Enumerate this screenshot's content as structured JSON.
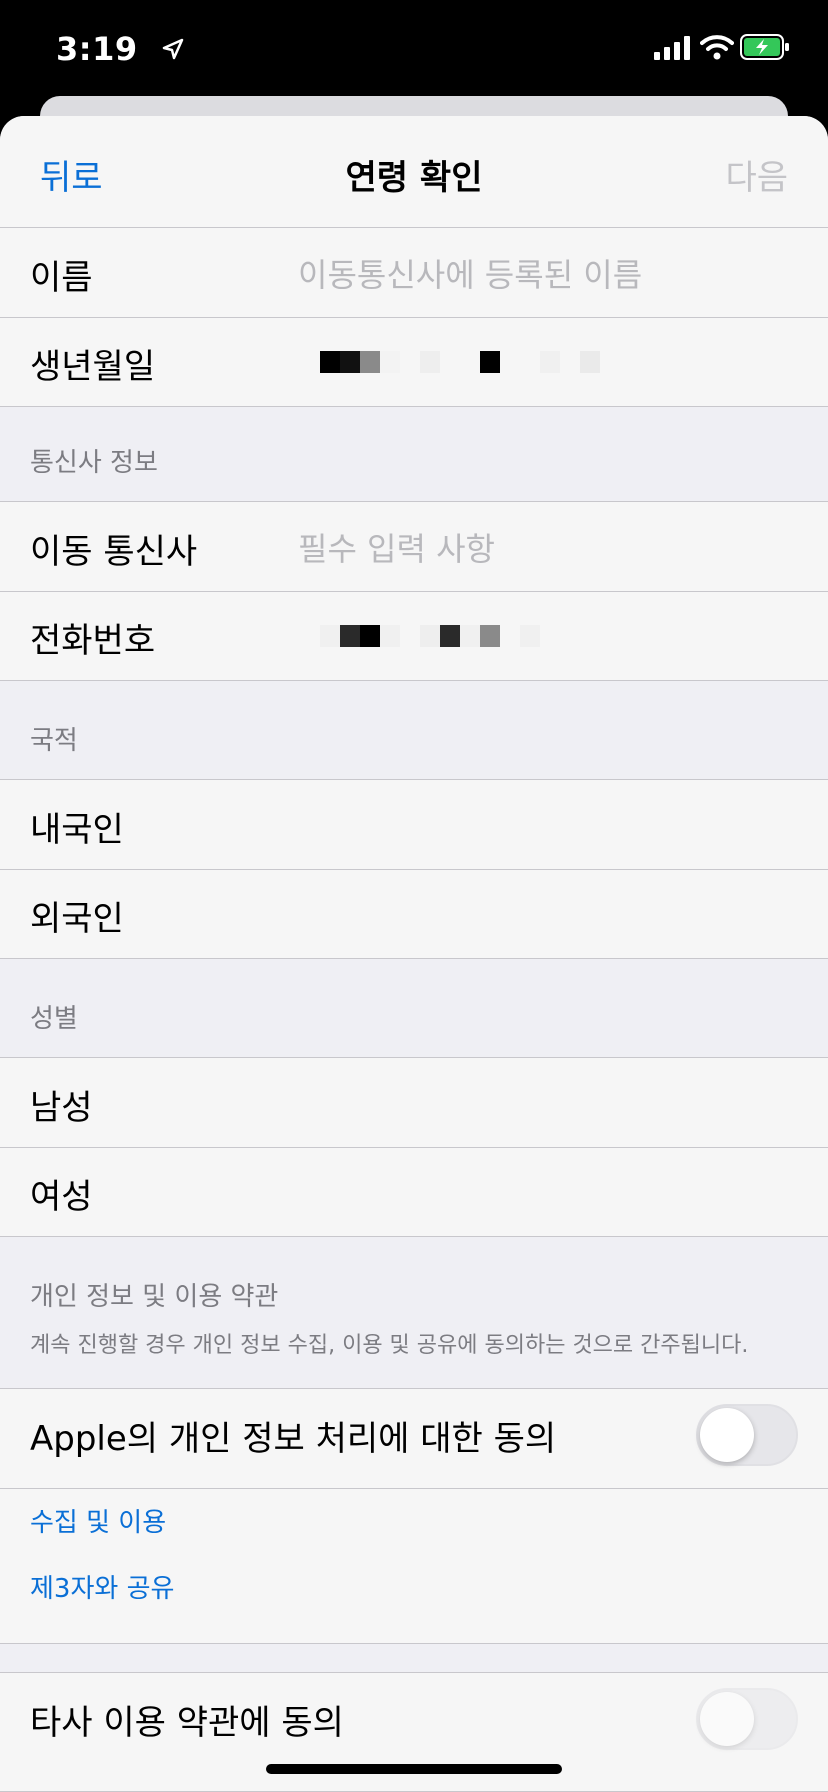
{
  "status_bar": {
    "time": "3:19",
    "icons": [
      "location-arrow-icon",
      "cellular-signal-icon",
      "wifi-icon",
      "battery-charging-icon"
    ],
    "battery_color": "#34c759"
  },
  "nav": {
    "back_label": "뒤로",
    "title": "연령 확인",
    "next_label": "다음"
  },
  "identity": {
    "name_label": "이름",
    "name_placeholder": "이동통신사에 등록된 이름",
    "birth_label": "생년월일"
  },
  "carrier_section": {
    "header": "통신사 정보",
    "carrier_label": "이동 통신사",
    "carrier_placeholder": "필수 입력 사항",
    "phone_label": "전화번호"
  },
  "nationality_section": {
    "header": "국적",
    "options": [
      "내국인",
      "외국인"
    ]
  },
  "gender_section": {
    "header": "성별",
    "options": [
      "남성",
      "여성"
    ]
  },
  "privacy": {
    "title": "개인 정보 및 이용 약관",
    "description": "계속 진행할 경우 개인 정보 수집, 이용 및 공유에 동의하는 것으로 간주됩니다.",
    "apple_consent_label": "Apple의 개인 정보 처리에 대한 동의",
    "apple_consent_on": false,
    "links": [
      "수집 및 이용",
      "제3자와 공유"
    ],
    "third_party_label": "타사 이용 약관에 동의",
    "third_party_on": false
  },
  "colors": {
    "accent": "#0a6fd6",
    "background": "#efeff4",
    "cell": "#f6f6f6"
  }
}
